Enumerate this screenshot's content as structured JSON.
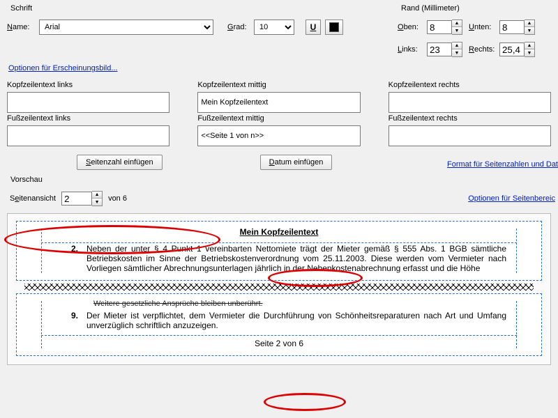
{
  "font": {
    "group_label": "Schrift",
    "name_label": "Name:",
    "name_underline": "N",
    "name_value": "Arial",
    "size_label": "Grad:",
    "size_underline": "G",
    "size_value": "10",
    "underline_icon": "U",
    "color_value": "#000000"
  },
  "margins": {
    "group_label": "Rand (Millimeter)",
    "top_label": "Oben:",
    "top_u": "O",
    "top_value": "8",
    "bottom_label": "Unten:",
    "bottom_u": "U",
    "bottom_value": "8",
    "left_label": "Links:",
    "left_u": "L",
    "left_value": "23",
    "right_label": "Rechts:",
    "right_u": "R",
    "right_value": "25,4"
  },
  "appearance_link": "Optionen für Erscheinungsbild...",
  "hf": {
    "hl_label": "Kopfzeilentext links",
    "hl_value": "",
    "hm_label": "Kopfzeilentext mittig",
    "hm_value": "Mein Kopfzeilentext",
    "hr_label": "Kopfzeilentext rechts",
    "hr_value": "",
    "fl_label": "Fußzeilentext links",
    "fl_value": "",
    "fm_label": "Fußzeilentext mittig",
    "fm_value": "<<Seite 1 von n>>",
    "fr_label": "Fußzeilentext rechts",
    "fr_value": ""
  },
  "buttons": {
    "insert_page": "Seitenzahl einfügen",
    "insert_page_u": "S",
    "insert_date": "Datum einfügen",
    "insert_date_u": "D",
    "format_link": "Format für Seitenzahlen und Dat"
  },
  "preview": {
    "group_label": "Vorschau",
    "pageview_label": "Seitenansicht",
    "pageview_u": "e",
    "current": "2",
    "total_text": "von 6",
    "range_link": "Optionen für Seitenbereic",
    "header_text": "Mein Kopfzeilentext",
    "para_top_num": "2.",
    "para_top_text": "Neben der unter § 4 Punkt 1 vereinbarten Nettomiete trägt der Mieter gemäß § 555 Abs. 1 BGB sämtliche Betriebskosten im Sinne der Betriebskostenverordnung vom 25.11.2003. Diese werden vom Vermieter nach Vorliegen sämtlicher Abrechnungsunterlagen jährlich in der Nebenkostenabrechnung erfasst und die Höhe",
    "para_mid_stub": "Weitere gesetzliche Ansprüche bleiben unberührt.",
    "para_bot_num": "9.",
    "para_bot_text": "Der Mieter ist verpflichtet, dem Vermieter die Durchführung von Schönheitsreparaturen nach Art und Umfang unverzüglich schriftlich anzuzeigen.",
    "footer_text": "Seite 2 von 6"
  }
}
